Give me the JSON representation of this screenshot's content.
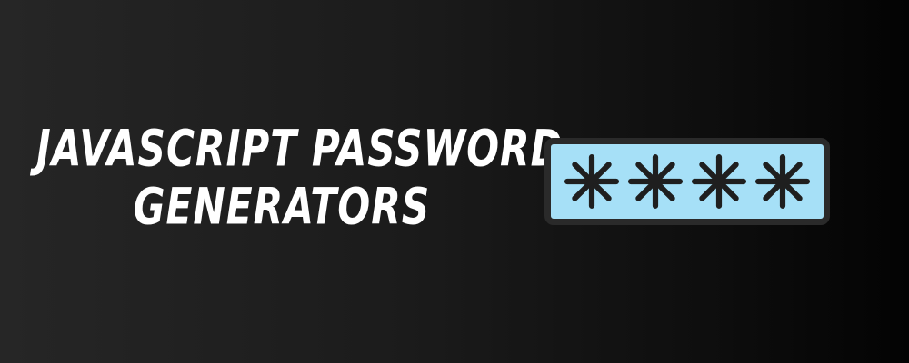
{
  "banner": {
    "title_lines": [
      "JavaScript Password",
      "Generators"
    ],
    "password_field": {
      "mask_chars": [
        "*",
        "*",
        "*",
        "*"
      ],
      "fill_color": "#a6e0f7",
      "border_color": "#2a2a2a",
      "icon": "asterisk-icon"
    },
    "background_colors": [
      "#262626",
      "#030303"
    ]
  }
}
